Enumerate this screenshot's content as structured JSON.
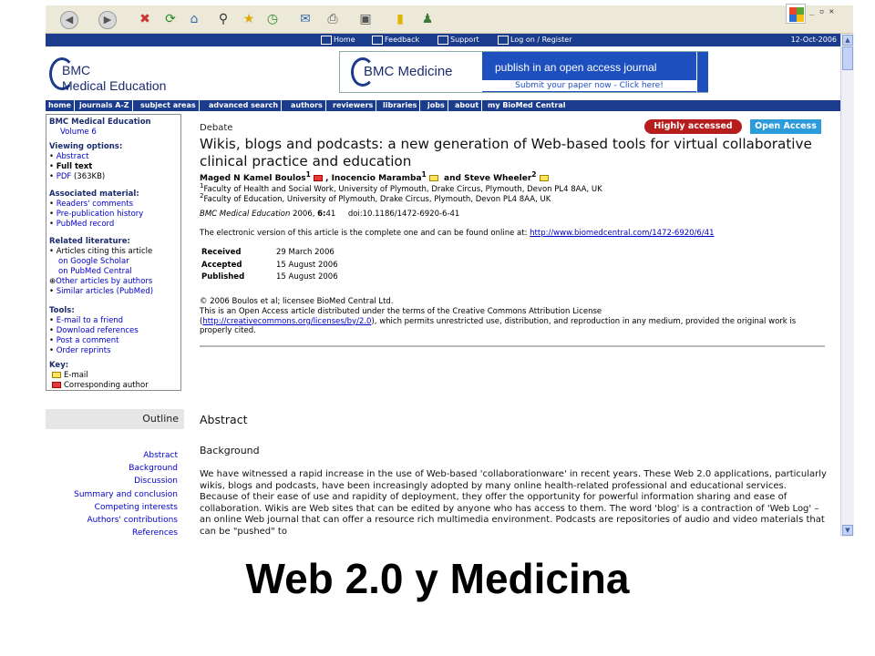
{
  "browser": {
    "window_controls": "_ ▫ ✕"
  },
  "site": {
    "topnav": [
      "Home",
      "Feedback",
      "Support",
      "Log on / Register"
    ],
    "date": "12-Oct-2006",
    "logo_line1": "BMC",
    "logo_line2": "Medical Education",
    "banner": {
      "brand": "BMC Medicine",
      "headline": "publish in an open access journal",
      "cta": "Submit your paper now - Click here!"
    },
    "mainnav": [
      "home",
      "journals A-Z",
      "subject areas",
      "advanced search",
      "authors",
      "reviewers",
      "libraries",
      "jobs",
      "about",
      "my BioMed Central"
    ]
  },
  "sidebar": {
    "journal": "BMC Medical Education",
    "volume": "Volume 6",
    "viewing_title": "Viewing options:",
    "viewing": [
      "Abstract",
      "Full text",
      "PDF"
    ],
    "pdf_size": "(363KB)",
    "assoc_title": "Associated material:",
    "assoc": [
      "Readers' comments",
      "Pre-publication history",
      "PubMed record"
    ],
    "related_title": "Related literature:",
    "related_citing": "Articles citing this article",
    "related_google": "on Google Scholar",
    "related_pubmed": "on PubMed Central",
    "related_other": "Other articles by authors",
    "related_similar": "Similar articles (PubMed)",
    "tools_title": "Tools:",
    "tools": [
      "E-mail to a friend",
      "Download references",
      "Post a comment",
      "Order reprints"
    ],
    "key_title": "Key:",
    "key_email": "E-mail",
    "key_corr": "Corresponding author"
  },
  "outline": {
    "title": "Outline",
    "items": [
      "Abstract",
      "Background",
      "Discussion",
      "Summary and conclusion",
      "Competing interests",
      "Authors' contributions",
      "References"
    ]
  },
  "article": {
    "type": "Debate",
    "badge_accessed": "Highly accessed",
    "badge_open": "Open Access",
    "title": "Wikis, blogs and podcasts: a new generation of Web-based tools for virtual collaborative clinical practice and education",
    "author1": "Maged N Kamel Boulos",
    "author2": "Inocencio Maramba",
    "author3": "Steve Wheeler",
    "aff1": "Faculty of Health and Social Work, University of Plymouth, Drake Circus, Plymouth, Devon PL4 8AA, UK",
    "aff2": "Faculty of Education, University of Plymouth, Drake Circus, Plymouth, Devon PL4 8AA, UK",
    "journal": "BMC Medical Education",
    "cite_rest": "2006,",
    "volume": "6:",
    "pages": "41",
    "doi": "doi:10.1186/1472-6920-6-41",
    "evers_text": "The electronic version of this article is the complete one and can be found online at:",
    "evers_url": "http://www.biomedcentral.com/1472-6920/6/41",
    "dates": [
      {
        "label": "Received",
        "value": "29 March 2006"
      },
      {
        "label": "Accepted",
        "value": "15 August 2006"
      },
      {
        "label": "Published",
        "value": "15 August 2006"
      }
    ],
    "copyright": "© 2006 Boulos et al; licensee BioMed Central Ltd.",
    "license_line": "This is an Open Access article distributed under the terms of the Creative Commons Attribution License",
    "license_url": "http://creativecommons.org/licenses/by/2.0",
    "license_rest": "), which permits unrestricted use, distribution, and reproduction in any medium, provided the original work is properly cited.",
    "abstract_heading": "Abstract",
    "background_heading": "Background",
    "background_text": "We have witnessed a rapid increase in the use of Web-based 'collaborationware' in recent years. These Web 2.0 applications, particularly wikis, blogs and podcasts, have been increasingly adopted by many online health-related professional and educational services. Because of their ease of use and rapidity of deployment, they offer the opportunity for powerful information sharing and ease of collaboration. Wikis are Web sites that can be edited by anyone who has access to them. The word 'blog' is a contraction of 'Web Log' – an online Web journal that can offer a resource rich multimedia environment. Podcasts are repositories of audio and video materials that can be \"pushed\" to"
  },
  "slide_caption": "Web 2.0 y Medicina",
  "colors": {
    "nav_blue": "#1b3b8c",
    "banner_blue": "#1e4fbf",
    "badge_red": "#b61d1d",
    "badge_blue": "#2b9bdc",
    "link": "#0000cc"
  }
}
